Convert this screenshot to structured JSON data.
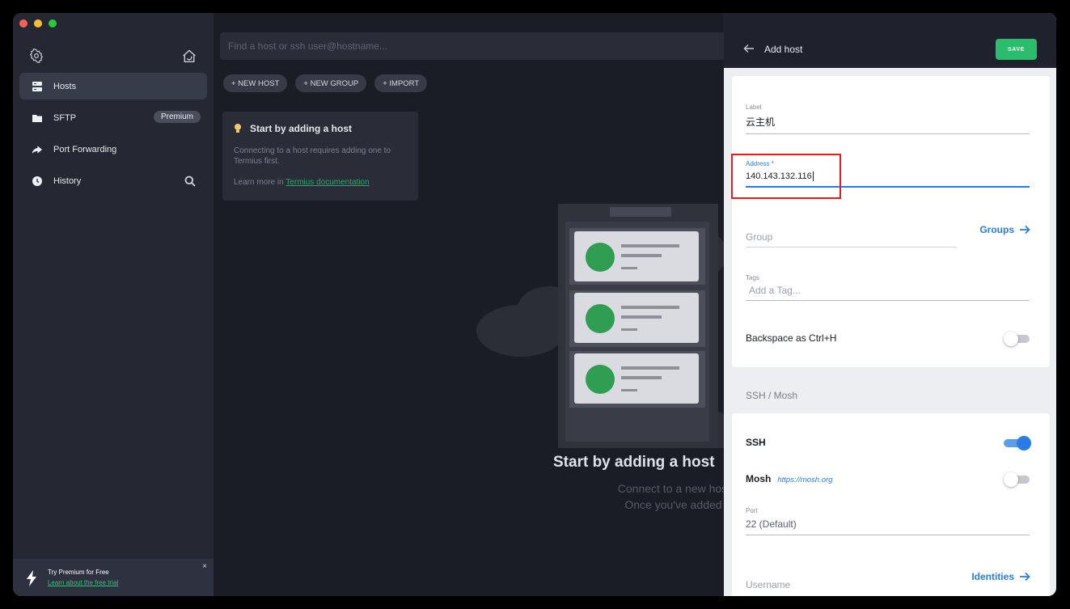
{
  "sidebar": {
    "items": [
      {
        "label": "Hosts",
        "icon": "hosts-icon",
        "active": true
      },
      {
        "label": "SFTP",
        "icon": "folder-icon",
        "badge": "Premium"
      },
      {
        "label": "Port Forwarding",
        "icon": "port-forwarding-icon"
      },
      {
        "label": "History",
        "icon": "history-icon"
      }
    ],
    "promo": {
      "title": "Try Premium for Free",
      "link": "Learn about the free trial",
      "close": "×"
    }
  },
  "main": {
    "search_placeholder": "Find a host or ssh user@hostname...",
    "toolbar": {
      "new_host": "+ NEW HOST",
      "new_group": "+ NEW GROUP",
      "import": "+ IMPORT"
    },
    "tip": {
      "title": "Start by adding a host",
      "body": "Connecting to a host requires adding one to Termius first.",
      "more_prefix": "Learn more in ",
      "more_link": "Termius documentation"
    },
    "empty": {
      "title": "Start by adding a host",
      "line1": "Connect to a new host via SSH, MOSH o",
      "line2": "Once you've added hosts, you'll find the"
    }
  },
  "panel": {
    "title": "Add host",
    "save": "SAVE",
    "label_field": {
      "label": "Label",
      "value": "云主机"
    },
    "address_field": {
      "label": "Address *",
      "value": "140.143.132.116"
    },
    "group_field": {
      "placeholder": "Group",
      "link": "Groups"
    },
    "tags_field": {
      "label": "Tags",
      "placeholder": "Add a Tag..."
    },
    "backspace": {
      "label": "Backspace as Ctrl+H",
      "on": false
    },
    "section": "SSH / Mosh",
    "ssh": {
      "label": "SSH",
      "on": true
    },
    "mosh": {
      "label": "Mosh",
      "link": "https://mosh.org",
      "on": false
    },
    "port": {
      "label": "Port",
      "value": "22 (Default)"
    },
    "username": {
      "placeholder": "Username",
      "link": "Identities"
    }
  },
  "colors": {
    "accent": "#2b7be6",
    "save": "#2bbd6e",
    "sidebar": "#252833",
    "highlight": "#e02020"
  }
}
